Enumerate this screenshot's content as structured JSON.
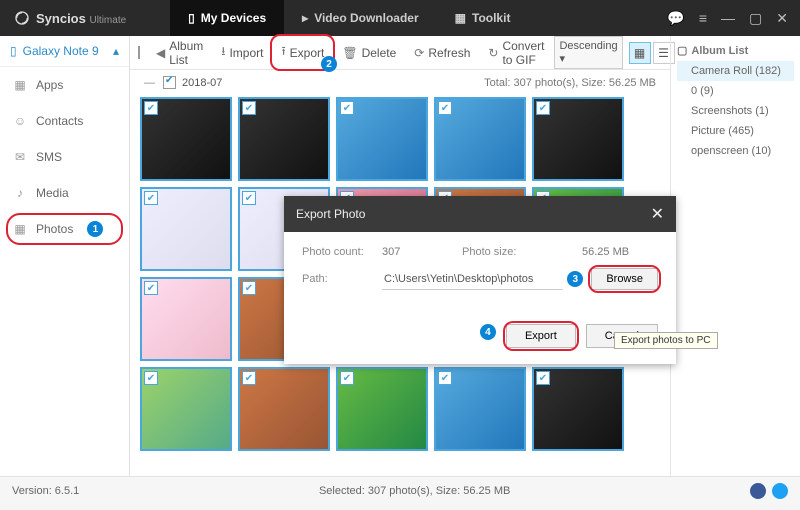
{
  "app": {
    "name": "Syncios",
    "edition": "Ultimate"
  },
  "topTabs": {
    "myDevices": "My Devices",
    "videoDownloader": "Video Downloader",
    "toolkit": "Toolkit"
  },
  "device": {
    "name": "Galaxy Note 9"
  },
  "leftNav": {
    "apps": "Apps",
    "contacts": "Contacts",
    "sms": "SMS",
    "media": "Media",
    "photos": "Photos"
  },
  "toolbar": {
    "albumList": "Album List",
    "import": "Import",
    "export": "Export",
    "delete": "Delete",
    "refresh": "Refresh",
    "convertGif": "Convert to GIF",
    "sort": "Descending ▾"
  },
  "group": {
    "label": "2018-07",
    "stats": "Total: 307 photo(s), Size: 56.25 MB"
  },
  "albumList": {
    "header": "Album List",
    "items": [
      {
        "label": "Camera Roll (182)"
      },
      {
        "label": "0 (9)"
      },
      {
        "label": "Screenshots (1)"
      },
      {
        "label": "Picture (465)"
      },
      {
        "label": "openscreen (10)"
      }
    ]
  },
  "dialog": {
    "title": "Export Photo",
    "countLabel": "Photo count:",
    "countValue": "307",
    "sizeLabel": "Photo size:",
    "sizeValue": "56.25 MB",
    "pathLabel": "Path:",
    "pathValue": "C:\\Users\\Yetin\\Desktop\\photos",
    "browse": "Browse",
    "export": "Export",
    "cancel": "Cancel"
  },
  "tooltip": "Export photos to PC",
  "callouts": {
    "n1": "1",
    "n2": "2",
    "n3": "3",
    "n4": "4"
  },
  "status": {
    "version": "Version: 6.5.1",
    "selection": "Selected: 307 photo(s), Size: 56.25 MB"
  }
}
